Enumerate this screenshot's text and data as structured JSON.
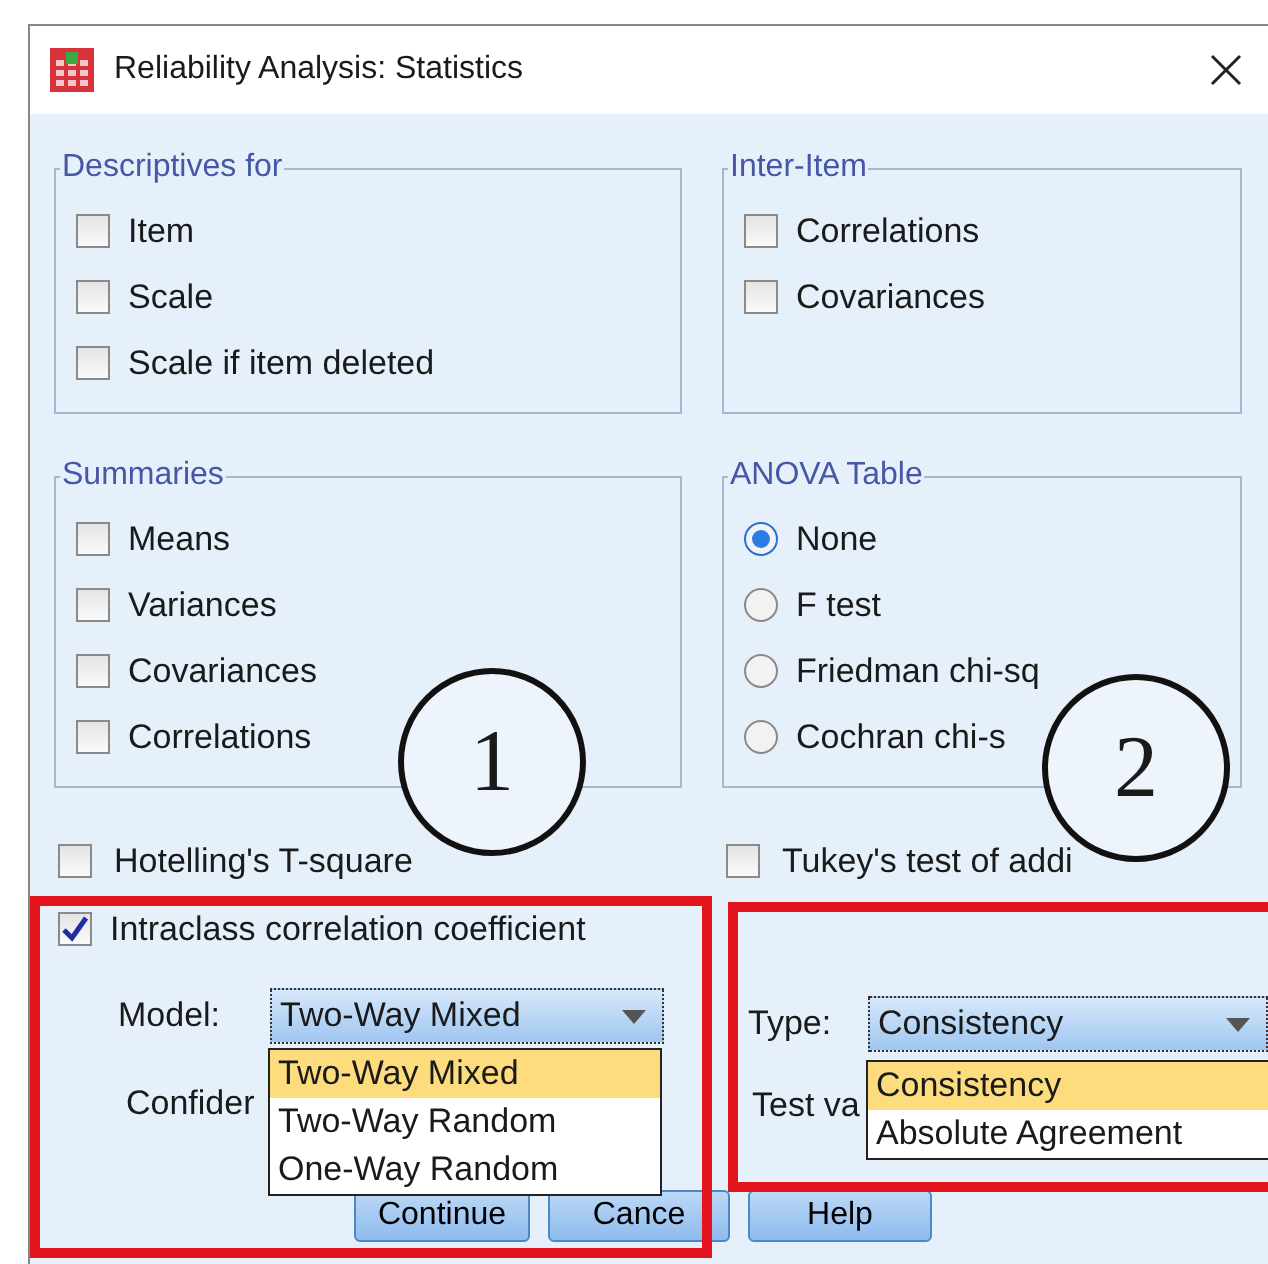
{
  "window": {
    "title": "Reliability Analysis: Statistics"
  },
  "groups": [
    {
      "title": "Descriptives for",
      "items": [
        {
          "kind": "checkbox",
          "label": "Item",
          "checked": false
        },
        {
          "kind": "checkbox",
          "label": "Scale",
          "checked": false
        },
        {
          "kind": "checkbox",
          "label": "Scale if item deleted",
          "checked": false
        }
      ]
    },
    {
      "title": "Inter-Item",
      "items": [
        {
          "kind": "checkbox",
          "label": "Correlations",
          "checked": false
        },
        {
          "kind": "checkbox",
          "label": "Covariances",
          "checked": false
        }
      ]
    },
    {
      "title": "Summaries",
      "items": [
        {
          "kind": "checkbox",
          "label": "Means",
          "checked": false
        },
        {
          "kind": "checkbox",
          "label": "Variances",
          "checked": false
        },
        {
          "kind": "checkbox",
          "label": "Covariances",
          "checked": false
        },
        {
          "kind": "checkbox",
          "label": "Correlations",
          "checked": false
        }
      ]
    },
    {
      "title": "ANOVA Table",
      "items": [
        {
          "kind": "radio",
          "label": "None",
          "selected": true
        },
        {
          "kind": "radio",
          "label": "F test",
          "selected": false
        },
        {
          "kind": "radio",
          "label": "Friedman chi-sq",
          "selected": false
        },
        {
          "kind": "radio",
          "label": "Cochran chi-s",
          "selected": false
        }
      ]
    }
  ],
  "options": [
    {
      "label": "Hotelling's T-square",
      "checked": false
    },
    {
      "label": "Tukey's test of addi",
      "checked": false
    }
  ],
  "icc": {
    "label": "Intraclass correlation coefficient",
    "checked": true,
    "model_label": "Model:",
    "model_value": "Two-Way Mixed",
    "model_options": [
      {
        "label": "Two-Way Mixed",
        "selected": true
      },
      {
        "label": "Two-Way Random",
        "selected": false
      },
      {
        "label": "One-Way Random",
        "selected": false
      }
    ],
    "confidence_label": "Confider",
    "type_label": "Type:",
    "type_value": "Consistency",
    "type_options": [
      {
        "label": "Consistency",
        "selected": true
      },
      {
        "label": "Absolute Agreement",
        "selected": false
      }
    ],
    "test_value_label": "Test va"
  },
  "buttons": [
    "Continue",
    "Cance",
    "Help"
  ],
  "annotations": [
    {
      "label": "1"
    },
    {
      "label": "2"
    }
  ]
}
